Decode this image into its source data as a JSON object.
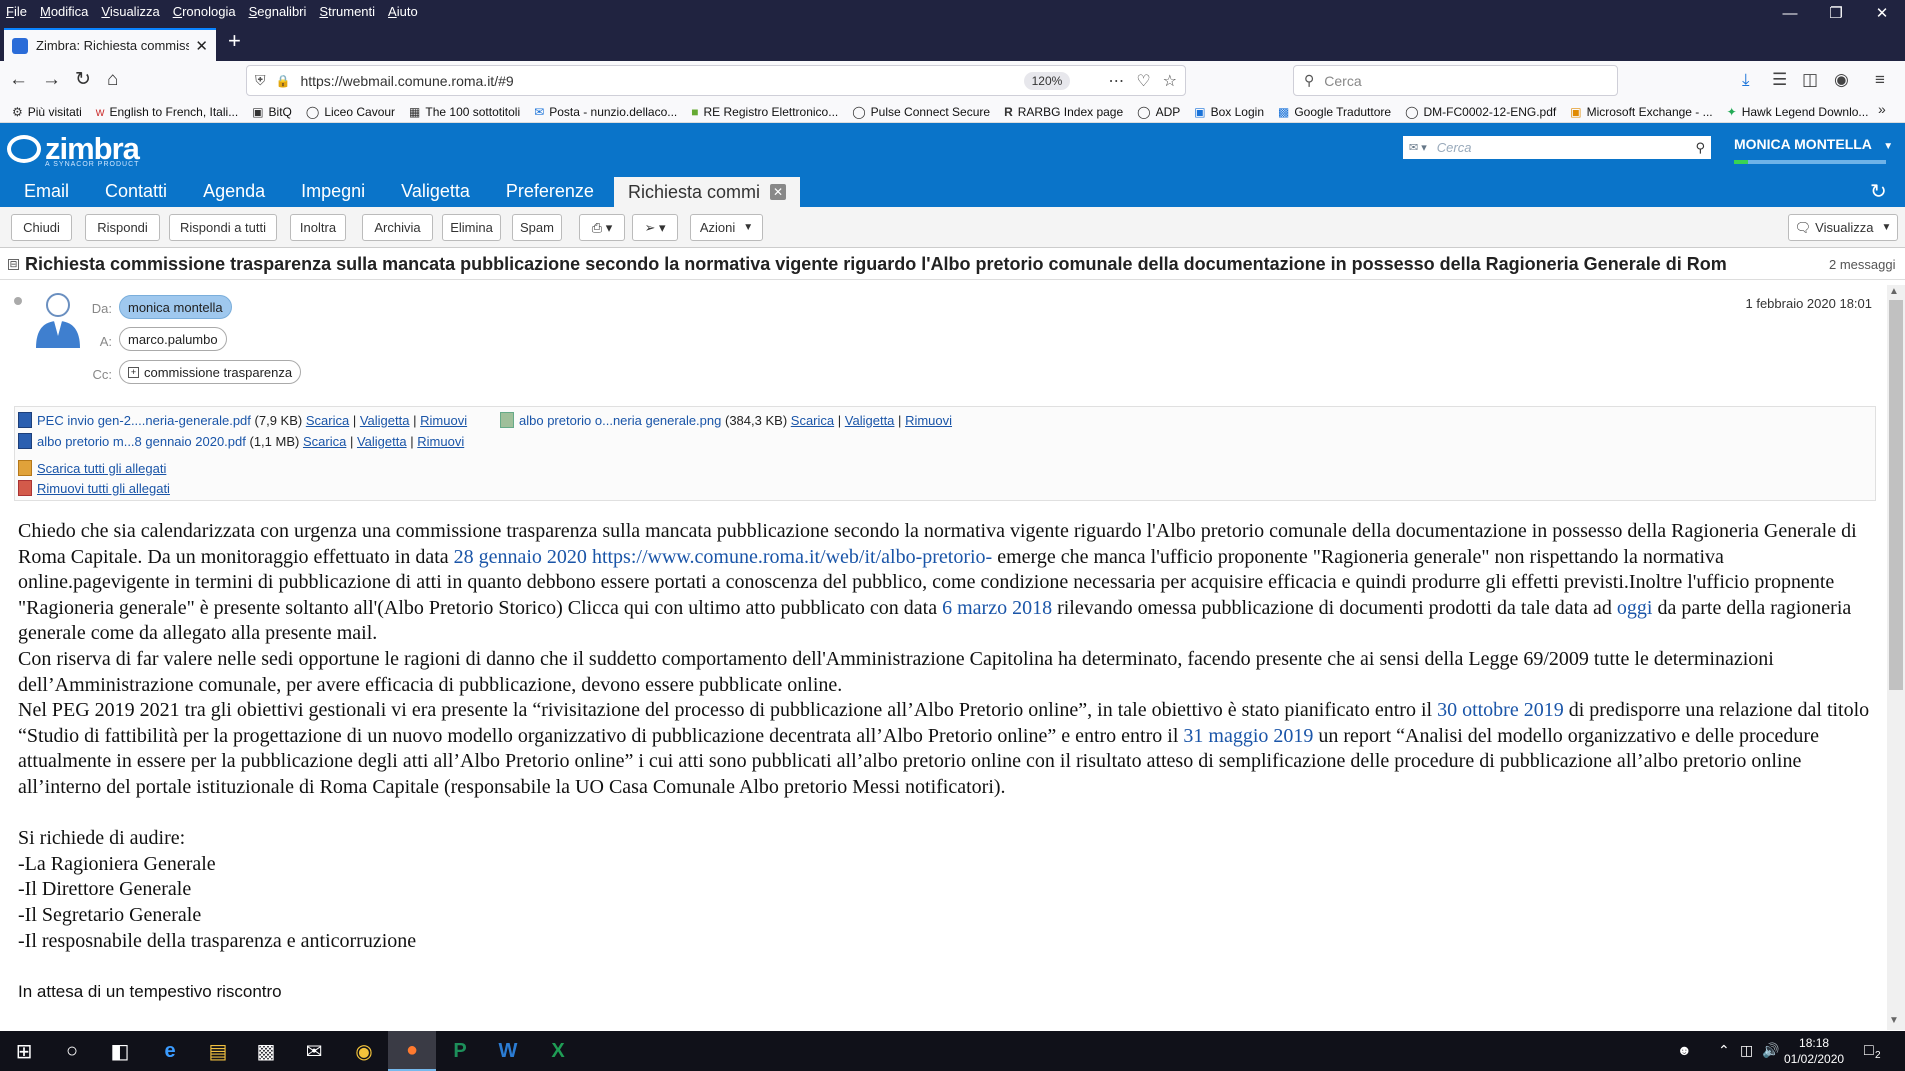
{
  "browser": {
    "menu": [
      "File",
      "Modifica",
      "Visualizza",
      "Cronologia",
      "Segnalibri",
      "Strumenti",
      "Aiuto"
    ],
    "tab_title": "Zimbra: Richiesta commissione",
    "url": "https://webmail.comune.roma.it/#9",
    "zoom": "120%",
    "search_placeholder": "Cerca",
    "bookmarks": [
      {
        "label": "Più visitati",
        "icon": "gear-icon"
      },
      {
        "label": "English to French, Itali...",
        "icon": "wr-icon"
      },
      {
        "label": "BitQ",
        "icon": "bitq-icon"
      },
      {
        "label": "Liceo Cavour",
        "icon": "globe-icon"
      },
      {
        "label": "The 100 sottotitoli",
        "icon": "film-icon"
      },
      {
        "label": "Posta - nunzio.dellaco...",
        "icon": "mail-icon"
      },
      {
        "label": "RE Registro Elettronico...",
        "icon": "folder-icon"
      },
      {
        "label": "Pulse Connect Secure",
        "icon": "globe-icon"
      },
      {
        "label": "RARBG Index page",
        "icon": "r-icon"
      },
      {
        "label": "ADP",
        "icon": "globe-icon"
      },
      {
        "label": "Box Login",
        "icon": "box-icon"
      },
      {
        "label": "Google Traduttore",
        "icon": "translate-icon"
      },
      {
        "label": "DM-FC0002-12-ENG.pdf",
        "icon": "globe-icon"
      },
      {
        "label": "Microsoft Exchange - ...",
        "icon": "outlook-icon"
      },
      {
        "label": "Hawk Legend Downlo...",
        "icon": "hawk-icon"
      }
    ]
  },
  "zimbra": {
    "logo_text": "zimbra",
    "logo_sub": "A SYNACOR PRODUCT",
    "search_placeholder": "Cerca",
    "user_name": "MONICA MONTELLA",
    "tabs": [
      "Email",
      "Contatti",
      "Agenda",
      "Impegni",
      "Valigetta",
      "Preferenze"
    ],
    "active_tab": "Richiesta commi",
    "toolbar": {
      "close": "Chiudi",
      "reply": "Rispondi",
      "reply_all": "Rispondi a tutti",
      "forward": "Inoltra",
      "archive": "Archivia",
      "delete": "Elimina",
      "spam": "Spam",
      "actions": "Azioni",
      "view": "Visualizza"
    }
  },
  "message": {
    "subject": "Richiesta commissione trasparenza sulla mancata pubblicazione secondo la normativa vigente riguardo l'Albo pretorio comunale della documentazione in possesso della Ragioneria Generale di Rom",
    "count": "2 messaggi",
    "from_label": "Da:",
    "from": "monica montella",
    "to_label": "A:",
    "to": "marco.palumbo",
    "cc_label": "Cc:",
    "cc": "commissione trasparenza",
    "date": "1 febbraio 2020 18:01",
    "attachments": [
      {
        "name": "PEC invio gen-2....neria-generale.pdf",
        "size": "(7,9 KB)"
      },
      {
        "name": "albo pretorio o...neria generale.png",
        "size": "(384,3 KB)"
      },
      {
        "name": "albo pretorio m...8 gennaio 2020.pdf",
        "size": "(1,1 MB)"
      }
    ],
    "att_actions": {
      "download": "Scarica",
      "briefcase": "Valigetta",
      "remove": "Rimuovi",
      "sep": "|"
    },
    "download_all": "Scarica tutti gli allegati",
    "remove_all": "Rimuovi tutti gli allegati",
    "body": {
      "p1a": "Chiedo che sia calendarizzata con urgenza una commissione trasparenza sulla mancata pubblicazione secondo la normativa vigente riguardo l'Albo pretorio comunale della documentazione in possesso della Ragioneria Generale di Roma Capitale. Da un monitoraggio effettuato in data ",
      "date1": "28 gennaio 2020",
      "link1": "https://www.comune.roma.it/web/it/albo-pretorio-",
      "p1b": " emerge che manca l'ufficio proponente \"Ragioneria generale\" non rispettando la normativa online.pagevigente in termini di pubblicazione di atti in quanto debbono essere portati a conoscenza del pubblico, come condizione necessaria per acquisire efficacia e quindi produrre gli effetti previsti.Inoltre l'ufficio propnente \"Ragioneria generale\" è presente soltanto all'(Albo Pretorio Storico) Clicca qui con ultimo atto pubblicato con data ",
      "date2": "6 marzo 2018",
      "p1c": " rilevando omessa pubblicazione di documenti prodotti da tale data ad ",
      "date3": "oggi",
      "p1d": " da parte della ragioneria generale come da allegato alla presente mail.",
      "p2": "Con riserva di far valere nelle sedi opportune le ragioni di danno che il suddetto comportamento dell'Amministrazione Capitolina ha determinato, facendo presente che ai sensi della Legge 69/2009 tutte le determinazioni dell’Amministrazione comunale, per avere efficacia di pubblicazione, devono essere pubblicate online.",
      "p3a": "Nel PEG 2019 2021 tra gli obiettivi gestionali vi era presente la “rivisitazione del processo di pubblicazione all’Albo Pretorio online”, in tale obiettivo è stato pianificato entro il ",
      "date4": "30 ottobre 2019",
      "p3b": " di predisporre una relazione dal titolo “Studio di fattibilità per la progettazione di un nuovo modello organizzativo di pubblicazione decentrata all’Albo Pretorio online” e entro  entro il ",
      "date5": "31 maggio 2019",
      "p3c": " un report “Analisi del modello organizzativo e delle procedure attualmente in essere per la pubblicazione degli atti all’Albo Pretorio online” i cui atti sono pubblicati all’albo pretorio online con il risultato atteso di semplificazione delle procedure di pubblicazione all’albo pretorio online all’interno del portale istituzionale di Roma Capitale (responsabile la UO Casa Comunale Albo pretorio Messi notificatori).",
      "req_title": "Si richiede di audire:",
      "req_items": [
        "-La Ragioniera Generale",
        "-Il Direttore Generale",
        "-Il Segretario Generale",
        "-Il resposnabile della trasparenza e anticorruzione"
      ],
      "closing": "In attesa di un tempestivo riscontro"
    }
  },
  "taskbar": {
    "time": "18:18",
    "date": "01/02/2020",
    "notifications": "2"
  }
}
